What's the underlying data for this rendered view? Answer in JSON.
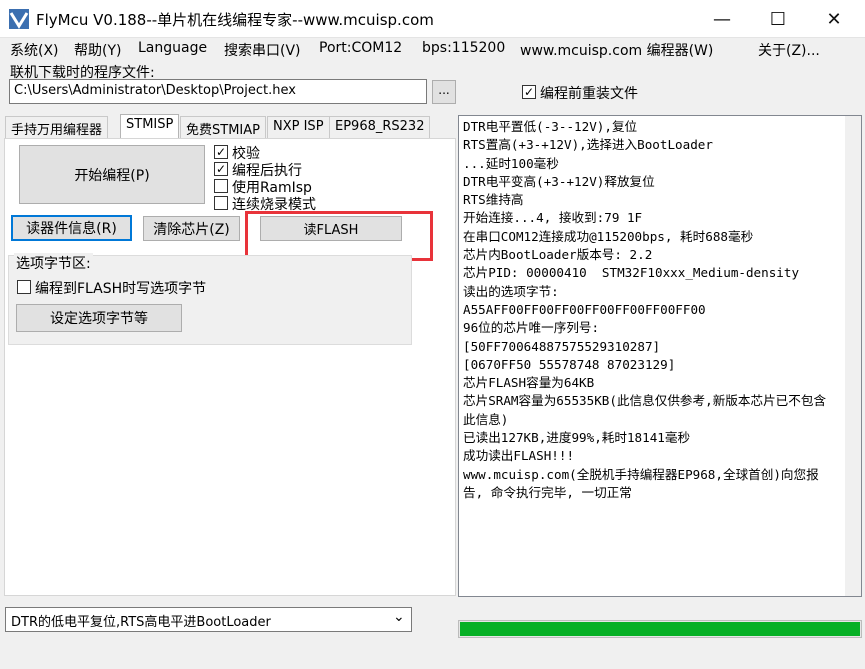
{
  "window": {
    "title": "FlyMcu V0.188--单片机在线编程专家--www.mcuisp.com",
    "minimize_glyph": "—",
    "maximize_glyph": "☐",
    "close_glyph": "✕",
    "icon": "flymcu-app-icon"
  },
  "menu": [
    "系统(X)",
    "帮助(Y)",
    "Language",
    "搜索串口(V)",
    "Port:COM12",
    "bps:115200",
    "www.mcuisp.com 编程器(W)",
    "关于(Z)..."
  ],
  "program_file": {
    "label": "联机下载时的程序文件:",
    "value": "C:\\Users\\Administrator\\Desktop\\Project.hex",
    "browse_label": "...",
    "reload_label": "编程前重装文件",
    "reload_checked": true
  },
  "tabs": [
    "手持万用编程器",
    "STMISP",
    "免费STMIAP",
    "NXP ISP",
    "EP968_RS232"
  ],
  "active_tab": "STMISP",
  "stmisp": {
    "start_button": "开始编程(P)",
    "options": [
      {
        "label": "校验",
        "checked": true
      },
      {
        "label": "编程后执行",
        "checked": true
      },
      {
        "label": "使用RamIsp",
        "checked": false
      },
      {
        "label": "连续烧录模式",
        "checked": false
      }
    ],
    "read_info_button": "读器件信息(R)",
    "erase_button": "清除芯片(Z)",
    "read_flash_button": "读FLASH",
    "option_bytes_title": "选项字节区:",
    "option_bytes_checkbox": "编程到FLASH时写选项字节",
    "option_bytes_checked": false,
    "set_option_button": "设定选项字节等"
  },
  "bottom_select": {
    "value": "DTR的低电平复位,RTS高电平进BootLoader",
    "arrow": "⌄"
  },
  "log": {
    "lines": [
      "DTR电平置低(-3--12V),复位",
      "RTS置高(+3-+12V),选择进入BootLoader",
      "...延时100毫秒",
      "DTR电平变高(+3-+12V)释放复位",
      "RTS维持高",
      "开始连接...4, 接收到:79 1F",
      "在串口COM12连接成功@115200bps, 耗时688毫秒",
      "芯片内BootLoader版本号: 2.2",
      "芯片PID: 00000410  STM32F10xxx_Medium-density",
      "读出的选项字节:",
      "A55AFF00FF00FF00FF00FF00FF00FF00",
      "96位的芯片唯一序列号:",
      "[50FF70064887575529310287]",
      "[0670FF50 55578748 87023129]",
      "芯片FLASH容量为64KB",
      "芯片SRAM容量为65535KB(此信息仅供参考,新版本芯片已不包含此信息)",
      "已读出127KB,进度99%,耗时18141毫秒",
      "成功读出FLASH!!!",
      "www.mcuisp.com(全脱机手持编程器EP968,全球首创)向您报告, 命令执行完毕, 一切正常"
    ]
  },
  "progress": {
    "fraction": 1.0,
    "color": "#06b025"
  },
  "highlight_color": "#e8333a"
}
